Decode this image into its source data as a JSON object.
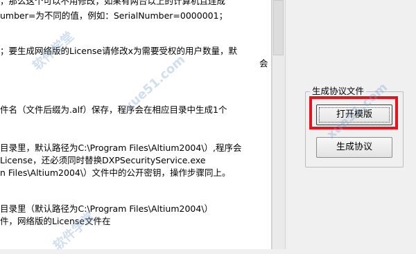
{
  "text_lines": [
    "umber=为不同的值，例如：SerialNumber=0000001；",
    "；要生成网络版的License请修改x为需要受权的用户数量，默",
    "会",
    "件名（文件后缀为.alf）保存，程序会在相应目录中生成1个",
    "目录里，默认路径为C:\\Program Files\\Altium2004\\）,程序会",
    "License，还必须同时替换DXPSecurityService.exe",
    "n Files\\Altium2004\\）文件中的公开密钥，操作步骤同上。",
    "目录里（默认路径为C:\\Program Files\\Altium2004\\）",
    "件，网络版的License文件在"
  ],
  "top_partial_line": "，那么这个可以不用修改，如果有两台以上的计算机且连成",
  "group": {
    "title": "生成协议文件",
    "open_template_label": "打开模版",
    "generate_label": "生成协议"
  },
  "highlight_color": "#e0151d",
  "watermark": [
    "软件学堂",
    "xue51.com",
    "软件学堂",
    "xue51.com"
  ]
}
